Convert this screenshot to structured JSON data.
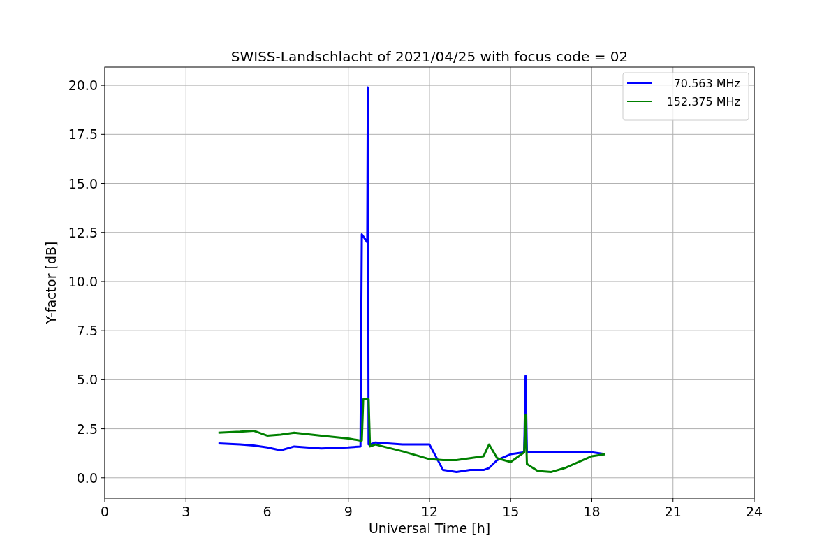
{
  "chart_data": {
    "type": "line",
    "title": "SWISS-Landschlacht of 2021/04/25 with focus code = 02",
    "xlabel": "Universal Time [h]",
    "ylabel": "Y-factor [dB]",
    "x": [
      4.2,
      5,
      5.5,
      6,
      6.5,
      7,
      8,
      9,
      9.45,
      9.5,
      9.55,
      9.7,
      9.72,
      9.75,
      9.8,
      10,
      11,
      12,
      12.5,
      13,
      13.5,
      14,
      14.2,
      14.5,
      15,
      15.5,
      15.55,
      15.6,
      16,
      16.5,
      17,
      18,
      18.5
    ],
    "series": [
      {
        "name": "70.563 MHz",
        "color": "#0000ff",
        "values": [
          1.75,
          1.7,
          1.65,
          1.55,
          1.4,
          1.6,
          1.5,
          1.55,
          1.6,
          12.4,
          12.3,
          12.0,
          19.9,
          1.7,
          1.7,
          1.8,
          1.7,
          1.7,
          0.4,
          0.3,
          0.4,
          0.4,
          0.5,
          0.9,
          1.2,
          1.3,
          5.2,
          1.3,
          1.3,
          1.3,
          1.3,
          1.3,
          1.2
        ]
      },
      {
        "name": "152.375 MHz",
        "color": "#008000",
        "values": [
          2.3,
          2.35,
          2.4,
          2.15,
          2.2,
          2.3,
          2.15,
          2.0,
          1.9,
          1.9,
          4.0,
          4.0,
          4.0,
          4.0,
          1.6,
          1.7,
          1.35,
          0.95,
          0.9,
          0.9,
          1.0,
          1.1,
          1.7,
          1.0,
          0.8,
          1.3,
          3.2,
          0.7,
          0.35,
          0.3,
          0.5,
          1.1,
          1.2
        ]
      }
    ],
    "grid": true,
    "legend": true,
    "xlim": [
      0,
      24
    ],
    "ylim": [
      -1.04,
      20.93
    ],
    "xticks": [
      0,
      3,
      6,
      9,
      12,
      15,
      18,
      21,
      24
    ],
    "yticks": [
      {
        "value": 0,
        "label": "0.0"
      },
      {
        "value": 2.5,
        "label": "2.5"
      },
      {
        "value": 5,
        "label": "5.0"
      },
      {
        "value": 7.5,
        "label": "7.5"
      },
      {
        "value": 10,
        "label": "10.0"
      },
      {
        "value": 12.5,
        "label": "12.5"
      },
      {
        "value": 15,
        "label": "15.0"
      },
      {
        "value": 17.5,
        "label": "17.5"
      },
      {
        "value": 20,
        "label": "20.0"
      }
    ]
  }
}
